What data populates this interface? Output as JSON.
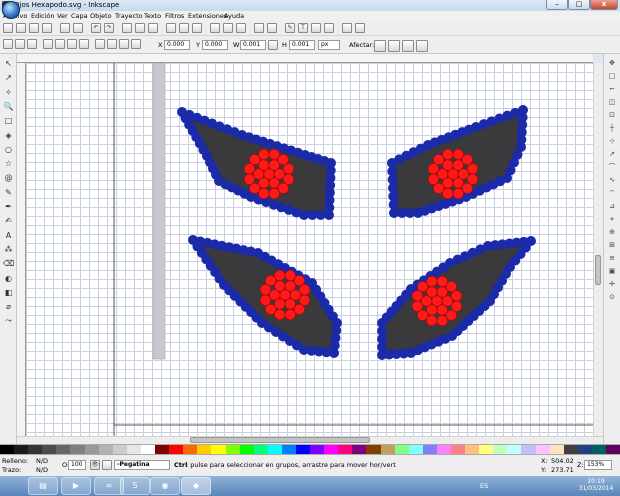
{
  "window": {
    "title": "Ojos Hexapodo.svg - Inkscape",
    "min_glyph": "–",
    "max_glyph": "□",
    "close_glyph": "x"
  },
  "menu": [
    "Archivo",
    "Edición",
    "Ver",
    "Capa",
    "Objeto",
    "Trayecto",
    "Texto",
    "Filtros",
    "Extensiones",
    "Ayuda"
  ],
  "toolbar2": {
    "x_label": "X",
    "x_value": "0.000",
    "y_label": "Y",
    "y_value": "0.000",
    "w_label": "W",
    "w_value": "0.001",
    "h_label": "H",
    "h_value": "0.001",
    "unit": "px",
    "affect_label": "Afectar:"
  },
  "status": {
    "fill_label": "Relleno:",
    "fill_value": "N/D",
    "stroke_label": "Trazo:",
    "stroke_value": "N/D",
    "opacity_label": "O:",
    "opacity_value": "100",
    "layer_value": "-Pegatina",
    "message_bold": "Ctrl",
    "message": ": pulse para seleccionar en grupos, arrastre para mover hor/vert",
    "x_label": "X:",
    "x_coord": "504.02",
    "y_label": "Y:",
    "y_coord": "273.71",
    "zoom_label": "Z:",
    "zoom": "153%"
  },
  "taskbar": {
    "lang": "ES",
    "time": "20:19",
    "date": "31/03/2014"
  },
  "icons": {
    "tools_left": [
      "selector-tool-icon",
      "node-tool-icon",
      "tweak-tool-icon",
      "zoom-tool-icon",
      "rect-tool-icon",
      "3dbox-tool-icon",
      "ellipse-tool-icon",
      "star-tool-icon",
      "spiral-tool-icon",
      "pencil-tool-icon",
      "pen-tool-icon",
      "calligraphy-tool-icon",
      "text-tool-icon",
      "spray-tool-icon",
      "eraser-tool-icon",
      "bucket-tool-icon",
      "gradient-tool-icon",
      "dropper-tool-icon",
      "connector-tool-icon"
    ]
  },
  "colors": {
    "eye_fill": "#3a3a3c",
    "eye_outline": "#1a2aa8",
    "pupil": "#ff1a1a",
    "pupil_stroke": "#c00000"
  },
  "palette": [
    "#000000",
    "#1a1a1a",
    "#333333",
    "#4d4d4d",
    "#666666",
    "#808080",
    "#999999",
    "#b3b3b3",
    "#cccccc",
    "#e6e6e6",
    "#ffffff",
    "#800000",
    "#ff0000",
    "#ff6600",
    "#ffcc00",
    "#ffff00",
    "#80ff00",
    "#00ff00",
    "#00ff80",
    "#00ffff",
    "#0080ff",
    "#0000ff",
    "#8000ff",
    "#ff00ff",
    "#ff0080",
    "#800080",
    "#804000",
    "#c0a060",
    "#80ff80",
    "#80ffff",
    "#8080ff",
    "#ff80ff",
    "#ff8080",
    "#ffc080",
    "#ffff80",
    "#c0ffc0",
    "#c0ffff",
    "#c0c0ff",
    "#ffc0ff",
    "#ffe0c0",
    "#404040",
    "#204080",
    "#006060",
    "#600060"
  ]
}
